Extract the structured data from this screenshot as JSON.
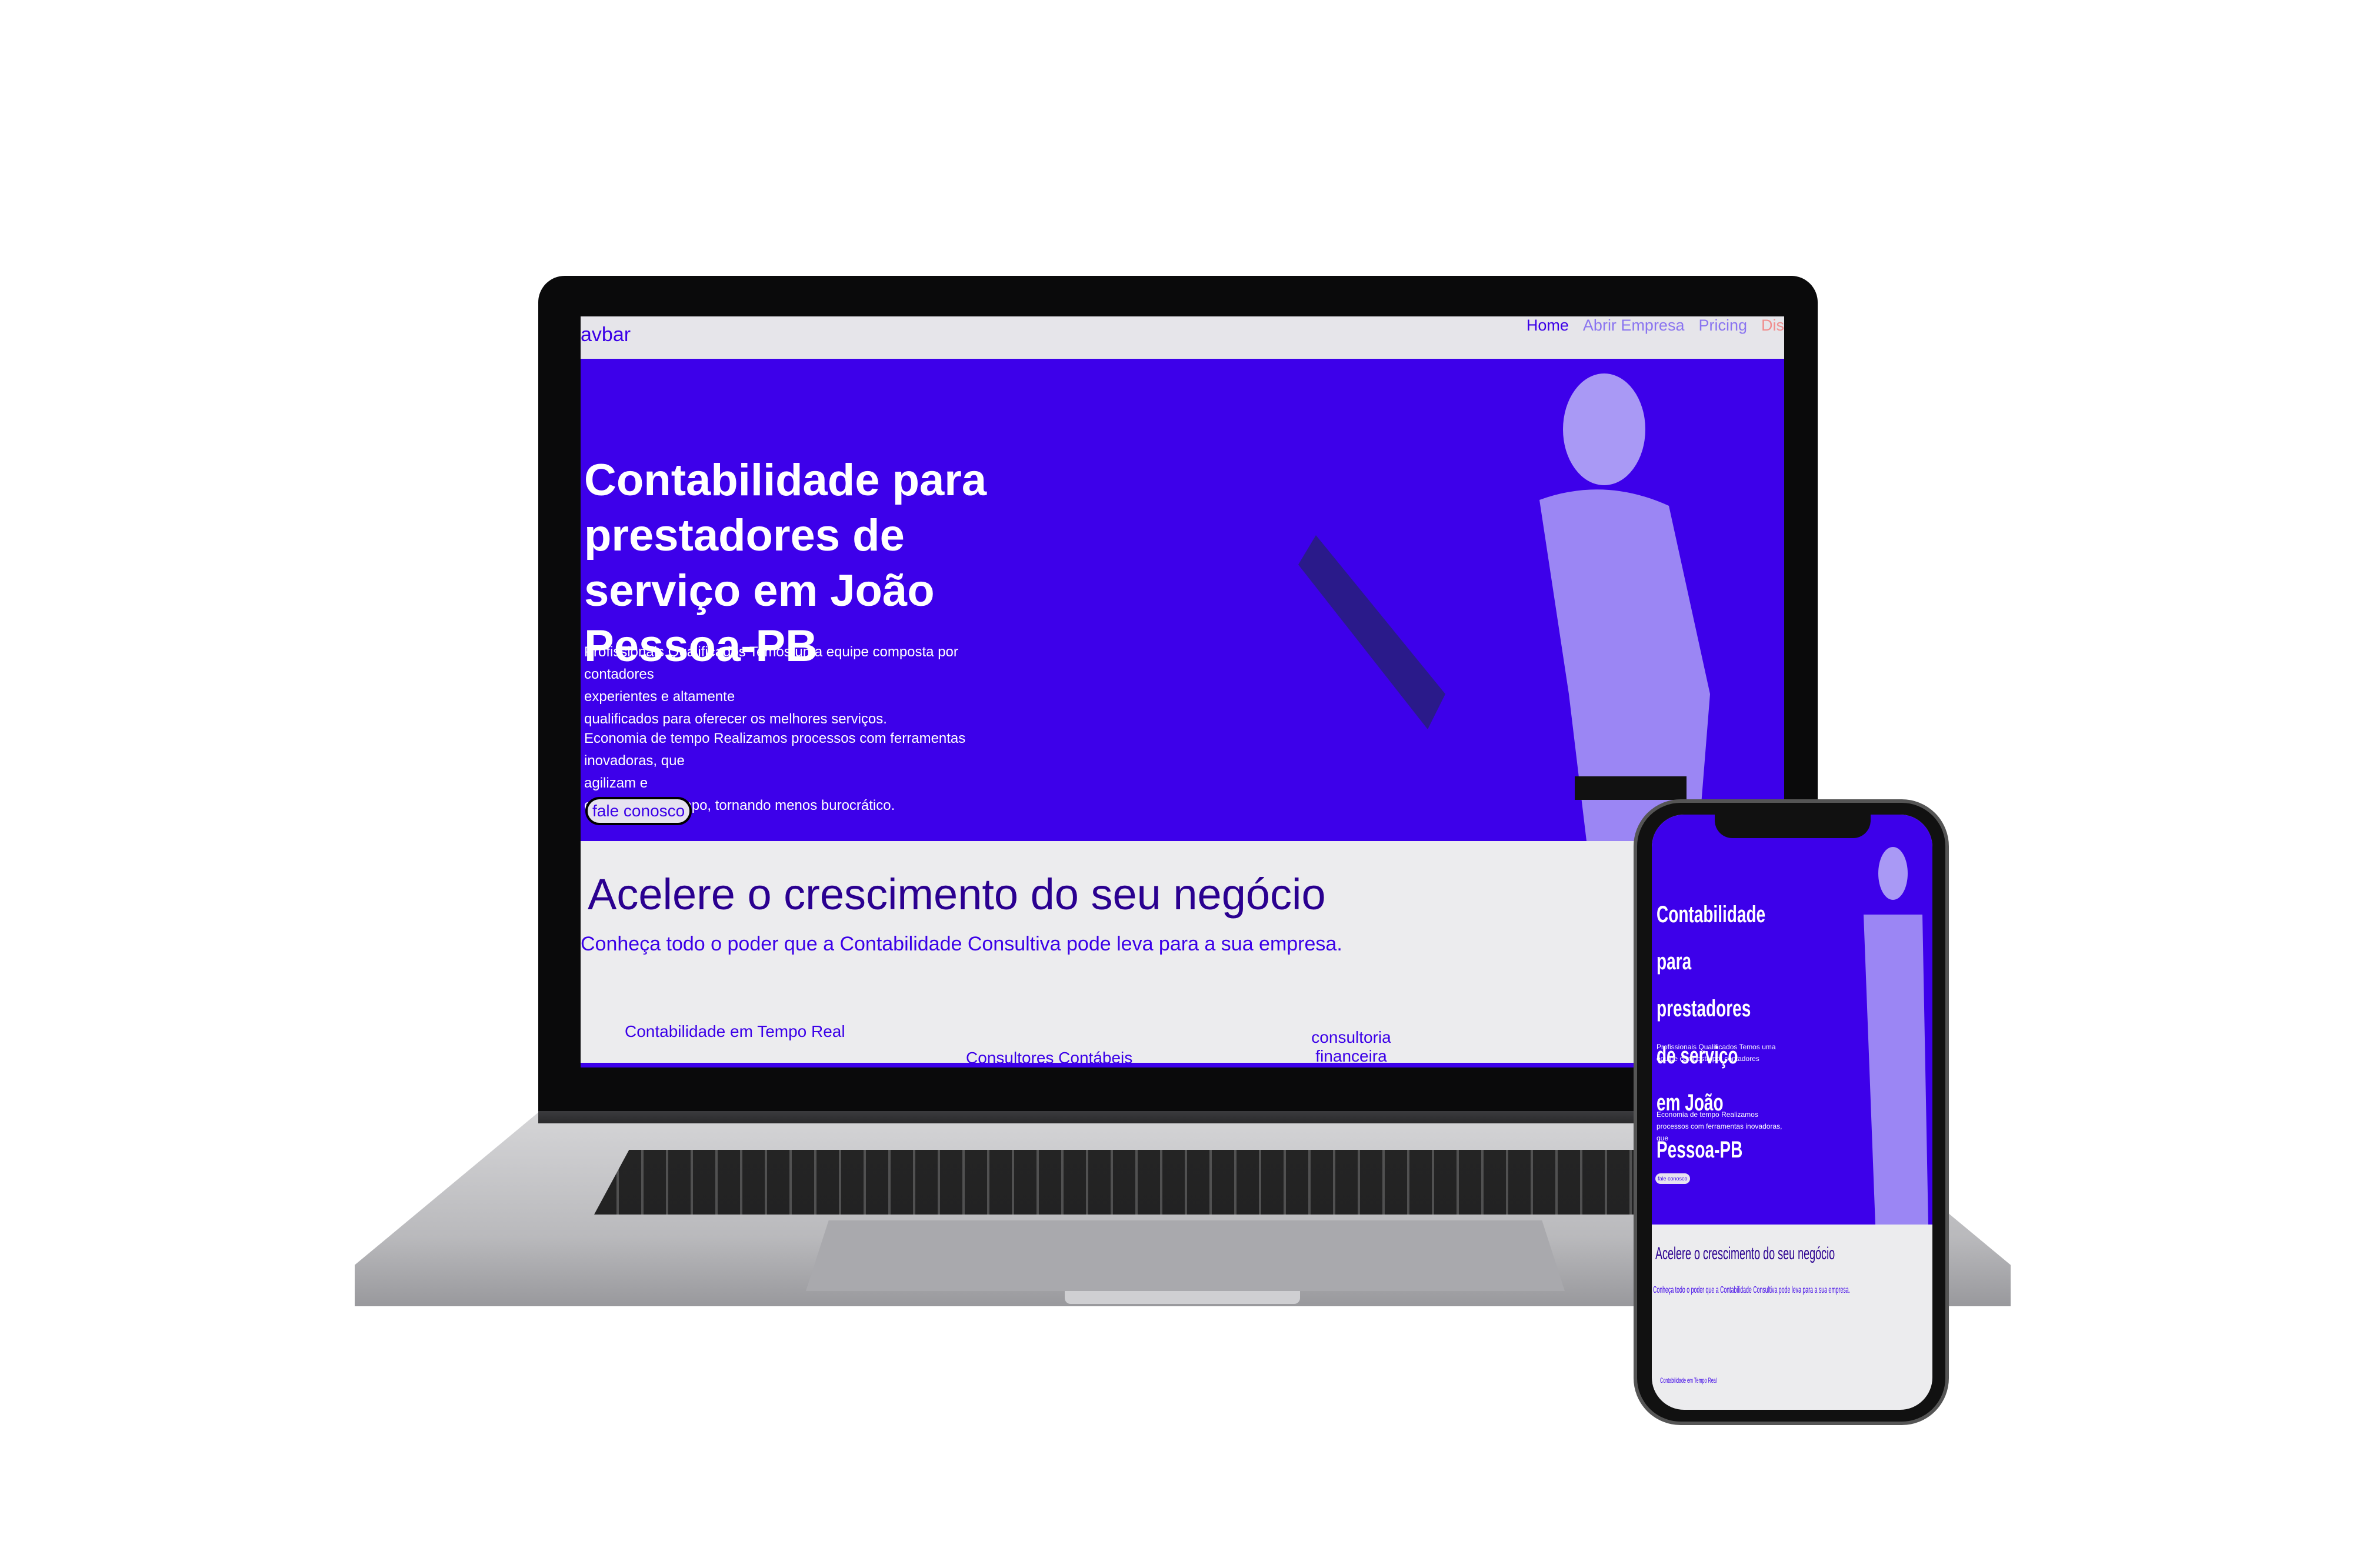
{
  "navbar": {
    "brand": "avbar",
    "links": [
      {
        "label": "Home"
      },
      {
        "label": "Abrir Empresa"
      },
      {
        "label": "Pricing"
      },
      {
        "label": "Dis"
      }
    ]
  },
  "hero": {
    "title": "Contabilidade para prestadores de serviço em João Pessoa-PB",
    "p1_line1": "Profissionais Qualificados Temos uma equipe composta por contadores",
    "p1_line2": "experientes e altamente",
    "p1_line3": "qualificados para oferecer os melhores serviços.",
    "p2_line1": "Economia de tempo Realizamos processos com ferramentas inovadoras, que",
    "p2_line2": "agilizam e",
    "p2_line3": "economizam tempo, tornando menos burocrático.",
    "cta": "fale conosco"
  },
  "section": {
    "title": "Acelere o crescimento do seu negócio",
    "subtitle": "Conheça todo o poder que a Contabilidade Consultiva pode leva para a sua empresa.",
    "cards": [
      {
        "title": "Contabilidade em Tempo Real"
      },
      {
        "title": "Consultores Contábeis"
      },
      {
        "title": "consultoria financeira"
      }
    ]
  },
  "colors": {
    "brand": "#3d00ea",
    "background": "#ececee"
  }
}
